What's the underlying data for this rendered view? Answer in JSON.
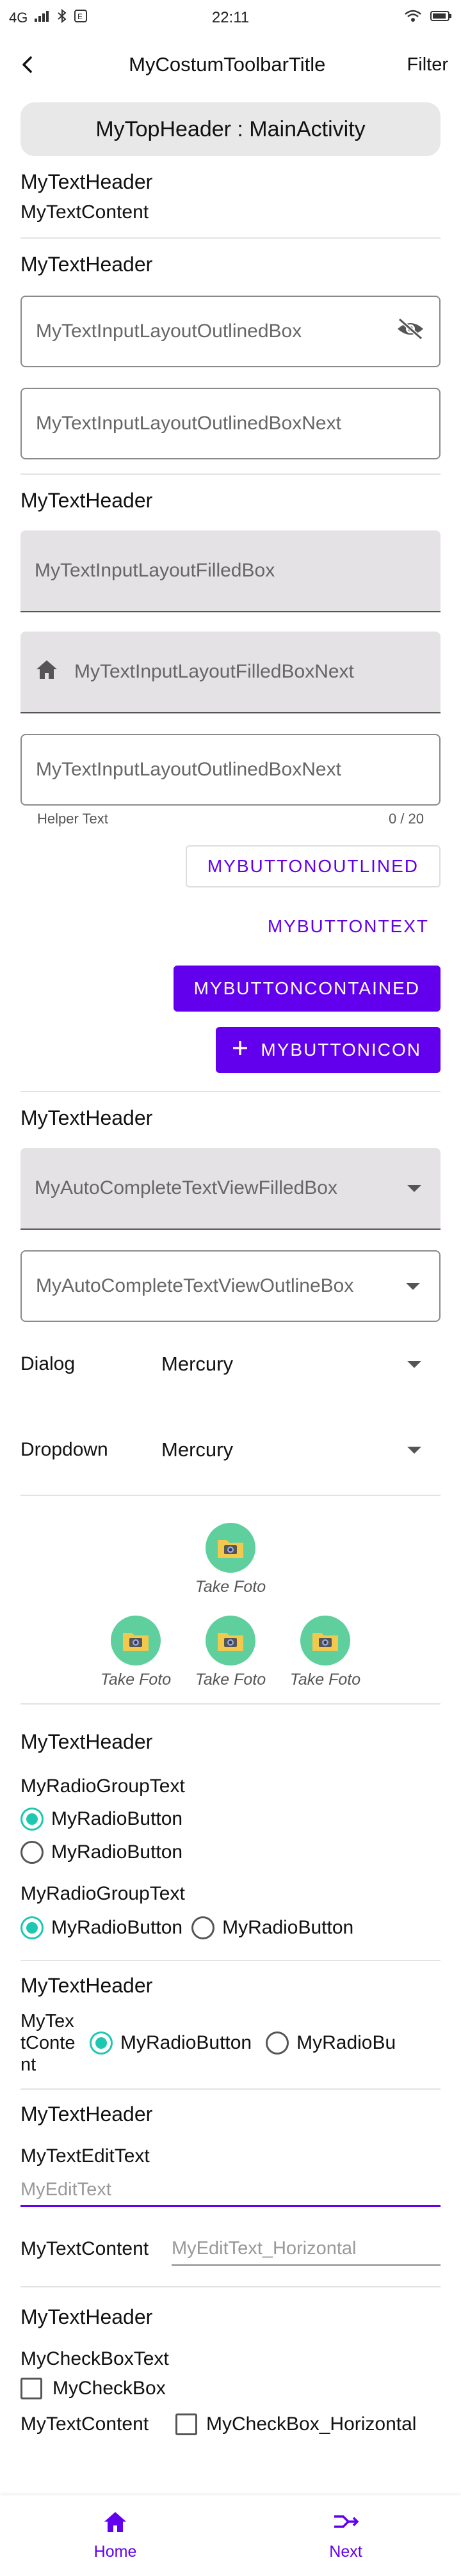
{
  "status_bar": {
    "network": "4G",
    "time": "22:11"
  },
  "toolbar": {
    "title": "MyCostumToolbarTitle",
    "action": "Filter",
    "back_icon": "arrow-back-icon"
  },
  "top_header": "MyTopHeader : MainActivity",
  "section1": {
    "header": "MyTextHeader",
    "content": "MyTextContent"
  },
  "section2": {
    "header": "MyTextHeader",
    "outlined_box": "MyTextInputLayoutOutlinedBox",
    "outlined_box_next": "MyTextInputLayoutOutlinedBoxNext"
  },
  "section3": {
    "header": "MyTextHeader",
    "filled_box": "MyTextInputLayoutFilledBox",
    "filled_box_next": "MyTextInputLayoutFilledBoxNext",
    "outlined_box_next": "MyTextInputLayoutOutlinedBoxNext",
    "helper_text": "Helper Text",
    "counter": "0 / 20",
    "btn_outlined": "MYBUTTONOUTLINED",
    "btn_text": "MYBUTTONTEXT",
    "btn_contained": "MYBUTTONCONTAINED",
    "btn_icon": "MYBUTTONICON"
  },
  "section4": {
    "header": "MyTextHeader",
    "autocomplete_filled": "MyAutoCompleteTextViewFilledBox",
    "autocomplete_outline": "MyAutoCompleteTextViewOutlineBox",
    "dialog_label": "Dialog",
    "dialog_value": "Mercury",
    "dropdown_label": "Dropdown",
    "dropdown_value": "Mercury"
  },
  "fotos": {
    "caption": "Take Foto"
  },
  "section5": {
    "header": "MyTextHeader",
    "group1_label": "MyRadioGroupText",
    "radio_label": "MyRadioButton",
    "group2_label": "MyRadioGroupText"
  },
  "section6": {
    "header": "MyTextHeader",
    "content": "MyTextContent",
    "radio_label": "MyRadioButton",
    "radio_label_cut": "MyRadioBu"
  },
  "section7": {
    "header": "MyTextHeader",
    "edit_label": "MyTextEditText",
    "edit_hint": "MyEditText",
    "content": "MyTextContent",
    "edit_hint_h": "MyEditText_Horizontal"
  },
  "section8": {
    "header": "MyTextHeader",
    "checkbox_label": "MyCheckBoxText",
    "checkbox": "MyCheckBox",
    "content": "MyTextContent",
    "checkbox_h": "MyCheckBox_Horizontal"
  },
  "bottom_nav": {
    "home": "Home",
    "next": "Next"
  },
  "colors": {
    "primary": "#6200ee",
    "teal": "#1ec8b0",
    "foto_green": "#5ecf9d"
  }
}
